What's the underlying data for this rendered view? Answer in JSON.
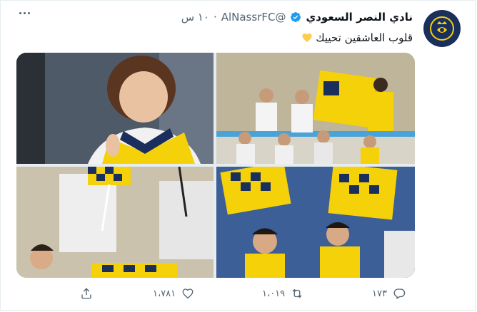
{
  "tweet": {
    "author_name": "نادي النصر السعودي",
    "handle": "@AlNassrFC",
    "separator": "·",
    "time": "١٠ س",
    "text": "قلوب العاشقين تحييك"
  },
  "images": [
    {
      "alt_icon": "photo-child-in-scarf"
    },
    {
      "alt_icon": "photo-crowd-in-stands"
    },
    {
      "alt_icon": "photo-boys-with-flags"
    },
    {
      "alt_icon": "photo-fans-yellow-shirts"
    }
  ],
  "actions": {
    "replies": "١٧٣",
    "retweets": "١،٠١٩",
    "likes": "١،٧٨١",
    "share_icon": "share-icon"
  },
  "colors": {
    "verified": "#1d9bf0",
    "heart": "#ffcc4d",
    "club_navy": "#1b2f5c",
    "club_yellow": "#f5d10a"
  }
}
